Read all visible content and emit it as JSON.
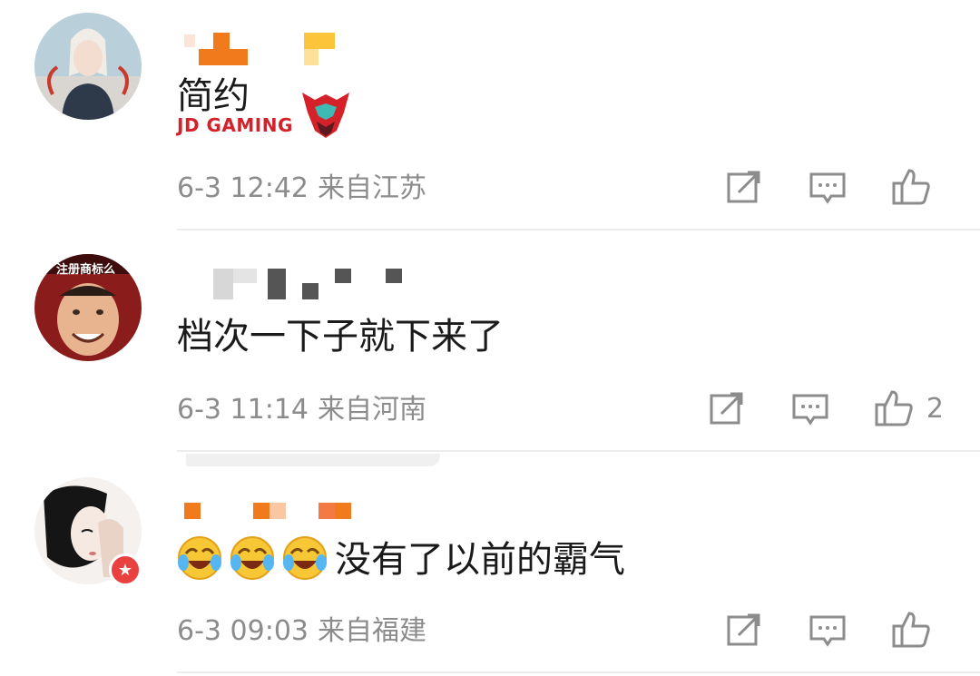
{
  "comments": [
    {
      "text": "简约",
      "badge_text": "JD GAMING",
      "time": "6-3 12:42",
      "location": "来自江苏",
      "like_count": ""
    },
    {
      "avatar_label": "注册商标么",
      "text": "档次一下子就下来了",
      "time": "6-3 11:14",
      "location": "来自河南",
      "like_count": "2"
    },
    {
      "text": "没有了以前的霸气",
      "time": "6-3 09:03",
      "location": "来自福建",
      "like_count": ""
    }
  ],
  "icons": {
    "share": "share-icon",
    "comment": "comment-icon",
    "like": "thumbs-up-icon",
    "emoji": "laugh-cry-emoji-icon"
  },
  "colors": {
    "meta_gray": "#8c8c8c",
    "text": "#1a1a1a",
    "orange_redaction": "#f07a1c",
    "jd_red": "#d4212a"
  }
}
